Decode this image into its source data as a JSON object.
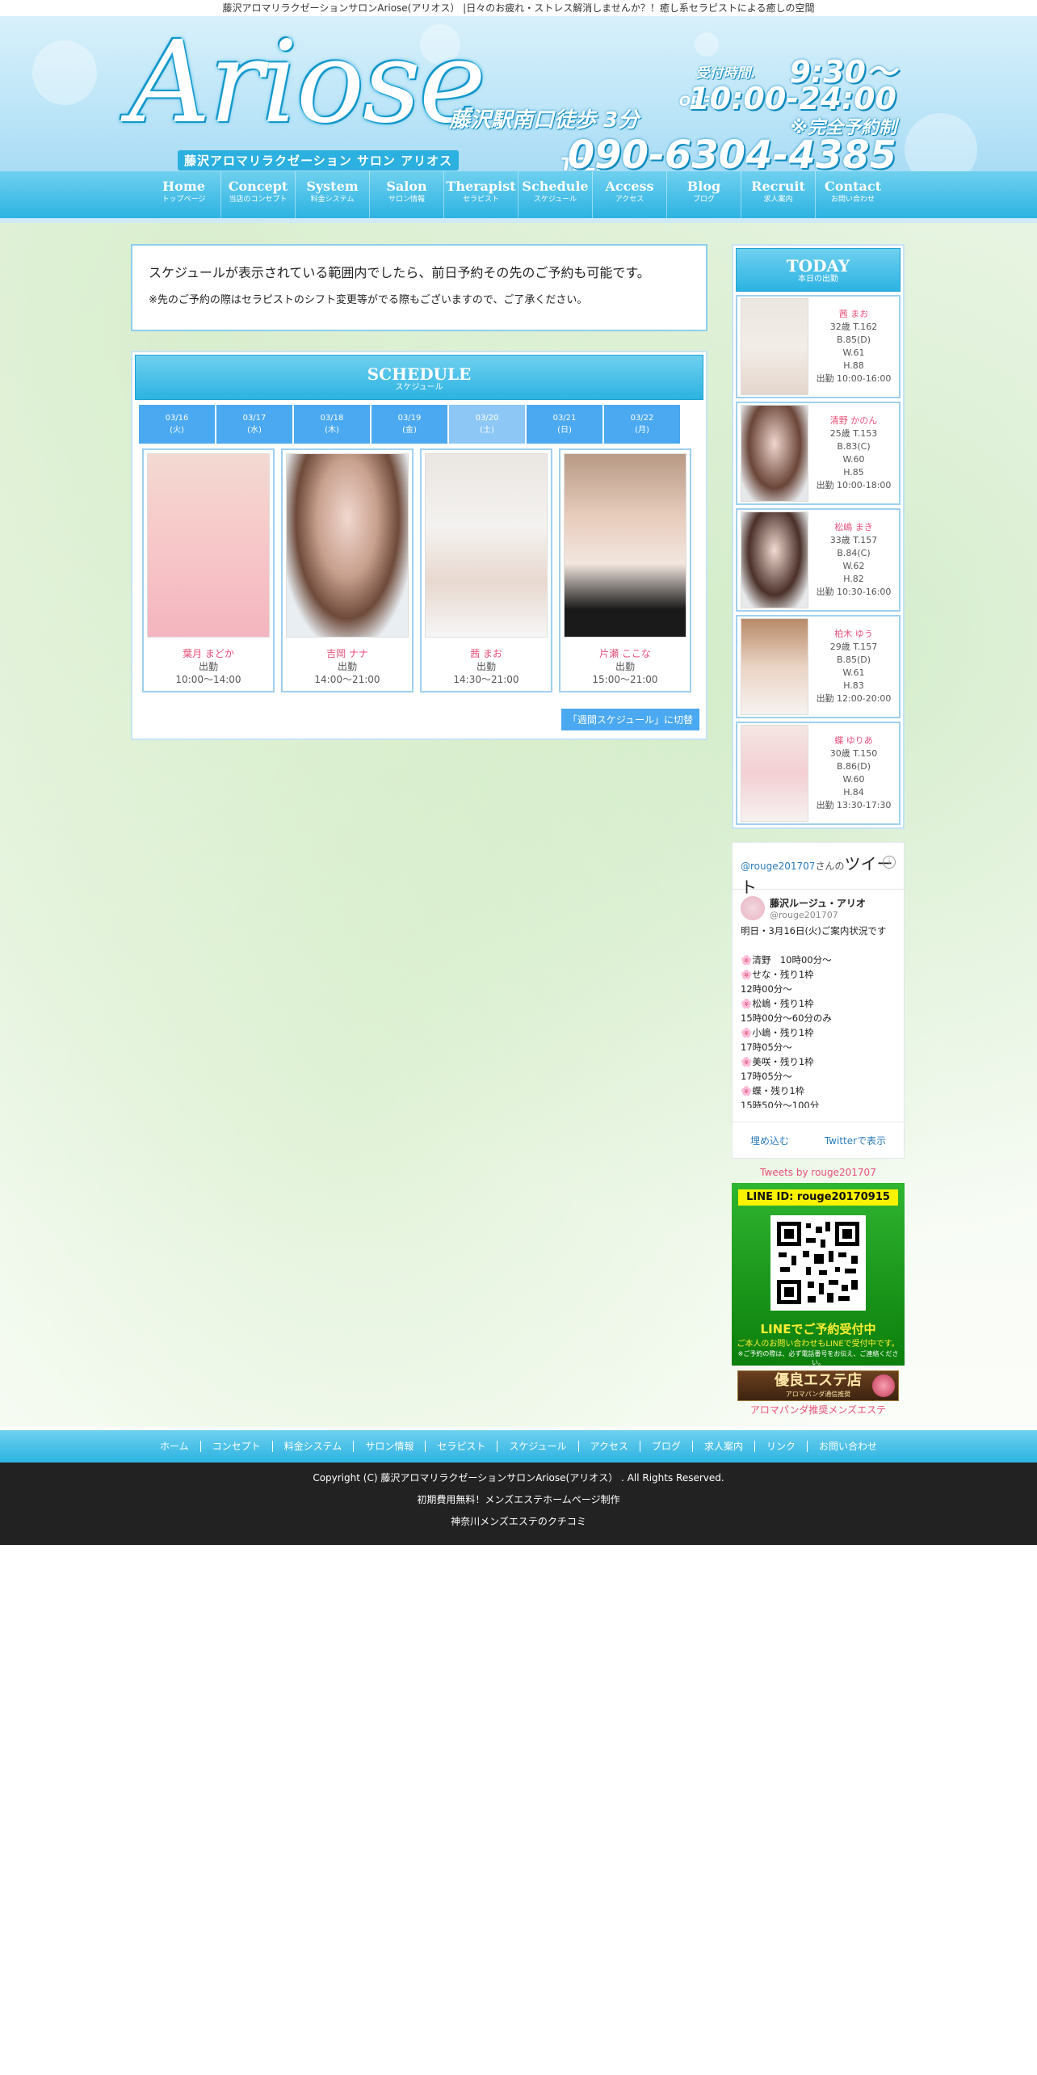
{
  "topbar": "藤沢アロマリラクゼーションサロンAriose(アリオス） |日々のお疲れ・ストレス解消しませんか？！癒し系セラピストによる癒しの空間",
  "header": {
    "logo": "Ariose",
    "logo_sub": "藤沢アロマリラクゼーション サロン アリオス",
    "station": "藤沢駅南口徒歩 3分",
    "reception_label": "受付時間.",
    "reception_time": "9:30～",
    "open_label": "OPEN.",
    "open_time": "10:00-24:00",
    "reservation": "※完全予約制",
    "tel_label": "TEL.",
    "tel": "090-6304-4385"
  },
  "nav": [
    {
      "en": "Home",
      "jp": "トップページ"
    },
    {
      "en": "Concept",
      "jp": "当店のコンセプト"
    },
    {
      "en": "System",
      "jp": "料金システム"
    },
    {
      "en": "Salon",
      "jp": "サロン情報"
    },
    {
      "en": "Therapist",
      "jp": "セラピスト"
    },
    {
      "en": "Schedule",
      "jp": "スケジュール"
    },
    {
      "en": "Access",
      "jp": "アクセス"
    },
    {
      "en": "Blog",
      "jp": "ブログ"
    },
    {
      "en": "Recruit",
      "jp": "求人案内"
    },
    {
      "en": "Contact",
      "jp": "お問い合わせ"
    }
  ],
  "notice": {
    "line1": "スケジュールが表示されている範囲内でしたら、前日予約その先のご予約も可能です。",
    "line2": "※先のご予約の際はセラピストのシフト変更等がでる際もございますので、ご了承ください。"
  },
  "schedule": {
    "title": "SCHEDULE",
    "subtitle": "スケジュール",
    "days": [
      {
        "date": "03/16",
        "dow": "(火)"
      },
      {
        "date": "03/17",
        "dow": "(水)"
      },
      {
        "date": "03/18",
        "dow": "(木)"
      },
      {
        "date": "03/19",
        "dow": "(金)"
      },
      {
        "date": "03/20",
        "dow": "(土)"
      },
      {
        "date": "03/21",
        "dow": "(日)"
      },
      {
        "date": "03/22",
        "dow": "(月)"
      }
    ],
    "cards": [
      {
        "name": "葉月 まどか",
        "status": "出勤",
        "time": "10:00～14:00"
      },
      {
        "name": "吉岡 ナナ",
        "status": "出勤",
        "time": "14:00～21:00"
      },
      {
        "name": "茜 まお",
        "status": "出勤",
        "time": "14:30～21:00"
      },
      {
        "name": "片瀬 ここな",
        "status": "出勤",
        "time": "15:00～21:00"
      }
    ],
    "weekly_button": "「週間スケジュール」に切替"
  },
  "today": {
    "title": "TODAY",
    "subtitle": "本日の出勤",
    "items": [
      {
        "name": "茜 まお",
        "age": "32歳 T.162",
        "b": "B.85(D)",
        "w": "W.61",
        "h": "H.88",
        "shift": "出勤 10:00-16:00"
      },
      {
        "name": "清野 かのん",
        "age": "25歳 T.153",
        "b": "B.83(C)",
        "w": "W.60",
        "h": "H.85",
        "shift": "出勤 10:00-18:00"
      },
      {
        "name": "松嶋 まき",
        "age": "33歳 T.157",
        "b": "B.84(C)",
        "w": "W.62",
        "h": "H.82",
        "shift": "出勤 10:30-16:00"
      },
      {
        "name": "柏木 ゆう",
        "age": "29歳 T.157",
        "b": "B.85(D)",
        "w": "W.61",
        "h": "H.83",
        "shift": "出勤 12:00-20:00"
      },
      {
        "name": "蝶 ゆりあ",
        "age": "30歳 T.150",
        "b": "B.86(D)",
        "w": "W.60",
        "h": "H.84",
        "shift": "出勤 13:30-17:30"
      }
    ]
  },
  "twitter": {
    "account": "@rouge201707",
    "san": "さんの",
    "tweet_word": "ツイート",
    "user_name": "藤沢ルージュ・アリオ",
    "user_handle": "@rouge201707",
    "body": "明日・3月16日(火)ご案内状況です\n\n🌸清野　10時00分～\n🌸せな・残り1枠\n12時00分～\n🌸松嶋・残り1枠\n15時00分～60分のみ\n🌸小嶋・残り1枠\n17時05分～\n🌸美咲・残り1枠\n17時05分～\n🌸蝶・残り1枠\n15時50分〜100分",
    "embed": "埋め込む",
    "view_on": "Twitterで表示",
    "tweets_by": "Tweets by rouge201707"
  },
  "line": {
    "id": "LINE ID:  rouge20170915",
    "t1": "LINEでご予約受付中",
    "t2": "ご本人のお問い合わせもLINEで受付中です。",
    "t3": "※ご予約の際は、必ず電話番号をお伝え、ご連絡ください。"
  },
  "banner": {
    "main": "優良エステ店",
    "sub": "アロマパンダ通信推奨",
    "caption": "アロマパンダ推奨メンズエステ"
  },
  "footer_nav": [
    "ホーム",
    "コンセプト",
    "料金システム",
    "サロン情報",
    "セラピスト",
    "スケジュール",
    "アクセス",
    "ブログ",
    "求人案内",
    "リンク",
    "お問い合わせ"
  ],
  "footer": {
    "copyright": "Copyright (C)  藤沢アロマリラクゼーションサロンAriose(アリオス） . All Rights Reserved.",
    "line2": "初期費用無料！メンズエステホームページ制作",
    "line3": "神奈川メンズエステのクチコミ"
  },
  "colors": {
    "accent_blue": "#2cb3e2",
    "day_tab": "#4aa9f0",
    "name_pink": "#e8507a",
    "footer_dark": "#222222"
  }
}
